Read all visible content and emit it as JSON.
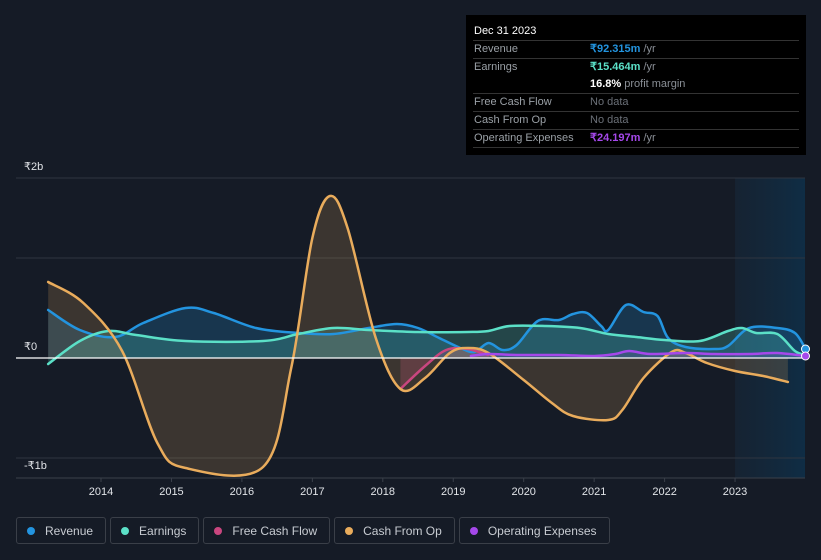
{
  "tooltip": {
    "date": "Dec 31 2023",
    "rows": [
      {
        "label": "Revenue",
        "value": "₹92.315m",
        "unit": " /yr",
        "color": "#2394df"
      },
      {
        "label": "Earnings",
        "value": "₹15.464m",
        "unit": " /yr",
        "color": "#5be0c7"
      },
      {
        "label": "",
        "value": "16.8%",
        "unit": " profit margin",
        "color": "#ffffff"
      },
      {
        "label": "Free Cash Flow",
        "value": "No data",
        "unit": "",
        "color": "#6b7078"
      },
      {
        "label": "Cash From Op",
        "value": "No data",
        "unit": "",
        "color": "#6b7078"
      },
      {
        "label": "Operating Expenses",
        "value": "₹24.197m",
        "unit": " /yr",
        "color": "#a548ea"
      }
    ]
  },
  "legend": [
    {
      "label": "Revenue",
      "color": "#2394df"
    },
    {
      "label": "Earnings",
      "color": "#5be0c7"
    },
    {
      "label": "Free Cash Flow",
      "color": "#c9467f"
    },
    {
      "label": "Cash From Op",
      "color": "#e9ac5c"
    },
    {
      "label": "Operating Expenses",
      "color": "#a548ea"
    }
  ],
  "chart_data": {
    "type": "line",
    "title": "",
    "xlabel": "",
    "ylabel": "",
    "x_ticks": [
      "2014",
      "2015",
      "2016",
      "2017",
      "2018",
      "2019",
      "2020",
      "2021",
      "2022",
      "2023"
    ],
    "y_tick_labels": [
      {
        "value": 2,
        "label": "₹2b"
      },
      {
        "value": 0,
        "label": "₹0"
      },
      {
        "value": -1,
        "label": "-₹1b"
      }
    ],
    "gridlines_at": [
      1.8,
      1,
      0,
      -1
    ],
    "ylim": [
      -1.2,
      1.8
    ],
    "xlim": [
      2012.7,
      2024.0
    ],
    "highlight_range": [
      2023.0,
      2024.0
    ],
    "units": "INR billions",
    "grid": true,
    "legend_position": "bottom",
    "series": [
      {
        "name": "Revenue",
        "color": "#2394df",
        "points": [
          [
            2013.25,
            0.48
          ],
          [
            2013.7,
            0.28
          ],
          [
            2014.2,
            0.21
          ],
          [
            2014.6,
            0.35
          ],
          [
            2015.2,
            0.5
          ],
          [
            2015.6,
            0.45
          ],
          [
            2016.2,
            0.3
          ],
          [
            2016.8,
            0.25
          ],
          [
            2017.3,
            0.24
          ],
          [
            2017.8,
            0.3
          ],
          [
            2018.2,
            0.34
          ],
          [
            2018.5,
            0.3
          ],
          [
            2018.8,
            0.2
          ],
          [
            2019.1,
            0.1
          ],
          [
            2019.3,
            0.06
          ],
          [
            2019.5,
            0.15
          ],
          [
            2019.7,
            0.08
          ],
          [
            2019.9,
            0.13
          ],
          [
            2020.2,
            0.37
          ],
          [
            2020.5,
            0.38
          ],
          [
            2020.7,
            0.44
          ],
          [
            2020.9,
            0.45
          ],
          [
            2021.1,
            0.32
          ],
          [
            2021.2,
            0.28
          ],
          [
            2021.45,
            0.53
          ],
          [
            2021.7,
            0.46
          ],
          [
            2021.9,
            0.42
          ],
          [
            2022.05,
            0.2
          ],
          [
            2022.3,
            0.11
          ],
          [
            2022.7,
            0.09
          ],
          [
            2022.9,
            0.12
          ],
          [
            2023.2,
            0.3
          ],
          [
            2023.6,
            0.3
          ],
          [
            2023.85,
            0.25
          ],
          [
            2024.0,
            0.09
          ]
        ]
      },
      {
        "name": "Earnings",
        "color": "#5be0c7",
        "points": [
          [
            2013.25,
            -0.06
          ],
          [
            2013.7,
            0.17
          ],
          [
            2014.1,
            0.27
          ],
          [
            2014.5,
            0.23
          ],
          [
            2015.2,
            0.17
          ],
          [
            2016.3,
            0.17
          ],
          [
            2016.8,
            0.24
          ],
          [
            2017.3,
            0.3
          ],
          [
            2017.8,
            0.28
          ],
          [
            2018.5,
            0.26
          ],
          [
            2019.2,
            0.26
          ],
          [
            2019.5,
            0.27
          ],
          [
            2019.8,
            0.32
          ],
          [
            2020.3,
            0.32
          ],
          [
            2020.8,
            0.3
          ],
          [
            2021.2,
            0.24
          ],
          [
            2021.6,
            0.21
          ],
          [
            2022.0,
            0.18
          ],
          [
            2022.5,
            0.17
          ],
          [
            2022.9,
            0.27
          ],
          [
            2023.1,
            0.3
          ],
          [
            2023.3,
            0.25
          ],
          [
            2023.6,
            0.24
          ],
          [
            2023.85,
            0.07
          ],
          [
            2024.0,
            0.03
          ]
        ]
      },
      {
        "name": "Free Cash Flow",
        "color": "#c9467f",
        "points": [
          [
            2018.25,
            -0.31
          ],
          [
            2018.6,
            -0.08
          ],
          [
            2018.9,
            0.08
          ],
          [
            2019.2,
            0.09
          ],
          [
            2019.5,
            0.03
          ]
        ]
      },
      {
        "name": "Cash From Op",
        "color": "#e9ac5c",
        "points": [
          [
            2013.25,
            0.76
          ],
          [
            2013.75,
            0.55
          ],
          [
            2014.3,
            0.07
          ],
          [
            2014.8,
            -0.85
          ],
          [
            2015.2,
            -1.1
          ],
          [
            2016.3,
            -1.09
          ],
          [
            2016.7,
            -0.1
          ],
          [
            2017.0,
            1.2
          ],
          [
            2017.25,
            1.62
          ],
          [
            2017.5,
            1.3
          ],
          [
            2017.9,
            0.2
          ],
          [
            2018.25,
            -0.31
          ],
          [
            2018.6,
            -0.2
          ],
          [
            2018.95,
            0.05
          ],
          [
            2019.2,
            0.1
          ],
          [
            2019.5,
            0.05
          ],
          [
            2020.0,
            -0.22
          ],
          [
            2020.4,
            -0.45
          ],
          [
            2020.7,
            -0.58
          ],
          [
            2021.2,
            -0.62
          ],
          [
            2021.4,
            -0.52
          ],
          [
            2021.7,
            -0.2
          ],
          [
            2022.1,
            0.06
          ],
          [
            2022.3,
            0.05
          ],
          [
            2022.6,
            -0.05
          ],
          [
            2023.0,
            -0.13
          ],
          [
            2023.4,
            -0.18
          ],
          [
            2023.75,
            -0.24
          ]
        ]
      },
      {
        "name": "Operating Expenses",
        "color": "#a548ea",
        "points": [
          [
            2019.25,
            0.02
          ],
          [
            2019.5,
            0.04
          ],
          [
            2019.9,
            0.03
          ],
          [
            2020.5,
            0.03
          ],
          [
            2021.0,
            0.02
          ],
          [
            2021.3,
            0.04
          ],
          [
            2021.5,
            0.07
          ],
          [
            2021.8,
            0.04
          ],
          [
            2022.3,
            0.05
          ],
          [
            2022.7,
            0.04
          ],
          [
            2023.2,
            0.04
          ],
          [
            2023.6,
            0.05
          ],
          [
            2024.0,
            0.02
          ]
        ]
      }
    ]
  }
}
